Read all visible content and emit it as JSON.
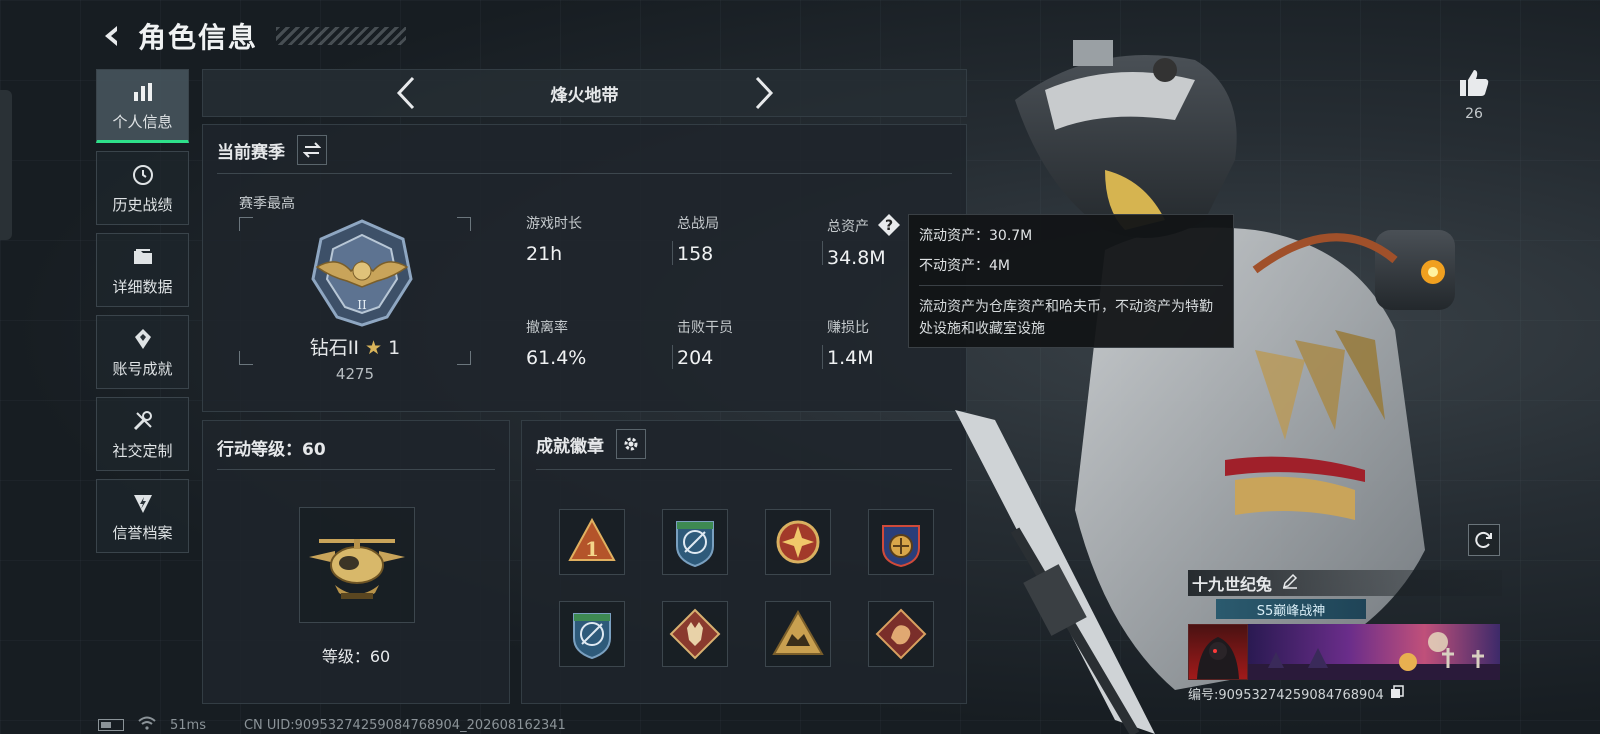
{
  "header": {
    "title": "角色信息"
  },
  "sidenav": {
    "items": [
      {
        "label": "个人信息",
        "icon": "bar-chart-icon",
        "active": true
      },
      {
        "label": "历史战绩",
        "icon": "history-icon"
      },
      {
        "label": "详细数据",
        "icon": "folder-icon"
      },
      {
        "label": "账号成就",
        "icon": "achievement-icon"
      },
      {
        "label": "社交定制",
        "icon": "tools-icon"
      },
      {
        "label": "信誉档案",
        "icon": "shield-bolt-icon"
      }
    ]
  },
  "mode": {
    "name": "烽火地带"
  },
  "season": {
    "label": "当前赛季",
    "best_label": "赛季最高",
    "rank_name": "钻石II",
    "rank_stars": "1",
    "rank_score": "4275",
    "stats": [
      {
        "key": "游戏时长",
        "value": "21h"
      },
      {
        "key": "总战局",
        "value": "158"
      },
      {
        "key": "总资产",
        "value": "34.8M"
      },
      {
        "key": "撤离率",
        "value": "61.4%"
      },
      {
        "key": "击败干员",
        "value": "204"
      },
      {
        "key": "赚损比",
        "value": "1.4M"
      }
    ]
  },
  "tooltip": {
    "liquid": "流动资产：30.7M",
    "fixed": "不动资产：4M",
    "desc": "流动资产为仓库资产和哈夫币，不动资产为特勤处设施和收藏室设施"
  },
  "action_level": {
    "title": "行动等级：60",
    "level_text": "等级：60"
  },
  "achievements": {
    "title": "成就徽章",
    "badges": [
      {
        "icon": "triangle-one-badge-icon"
      },
      {
        "icon": "compass-shield-badge-icon"
      },
      {
        "icon": "star-medal-badge-icon"
      },
      {
        "icon": "round-emblem-badge-icon"
      },
      {
        "icon": "compass-shield-badge-icon"
      },
      {
        "icon": "wolf-diamond-badge-icon"
      },
      {
        "icon": "eagle-triangle-badge-icon"
      },
      {
        "icon": "dragon-diamond-badge-icon"
      }
    ]
  },
  "social": {
    "likes": "26"
  },
  "player": {
    "name": "十九世纪兔",
    "title": "S5巅峰战神",
    "id_label": "编号:90953274259084768904"
  },
  "status": {
    "ping": "51ms",
    "uid": "CN UID:90953274259084768904_202608162341"
  },
  "colors": {
    "accent_green": "#2ee08a",
    "panel_bg": "#1e252b",
    "gold": "#c9a45a"
  }
}
